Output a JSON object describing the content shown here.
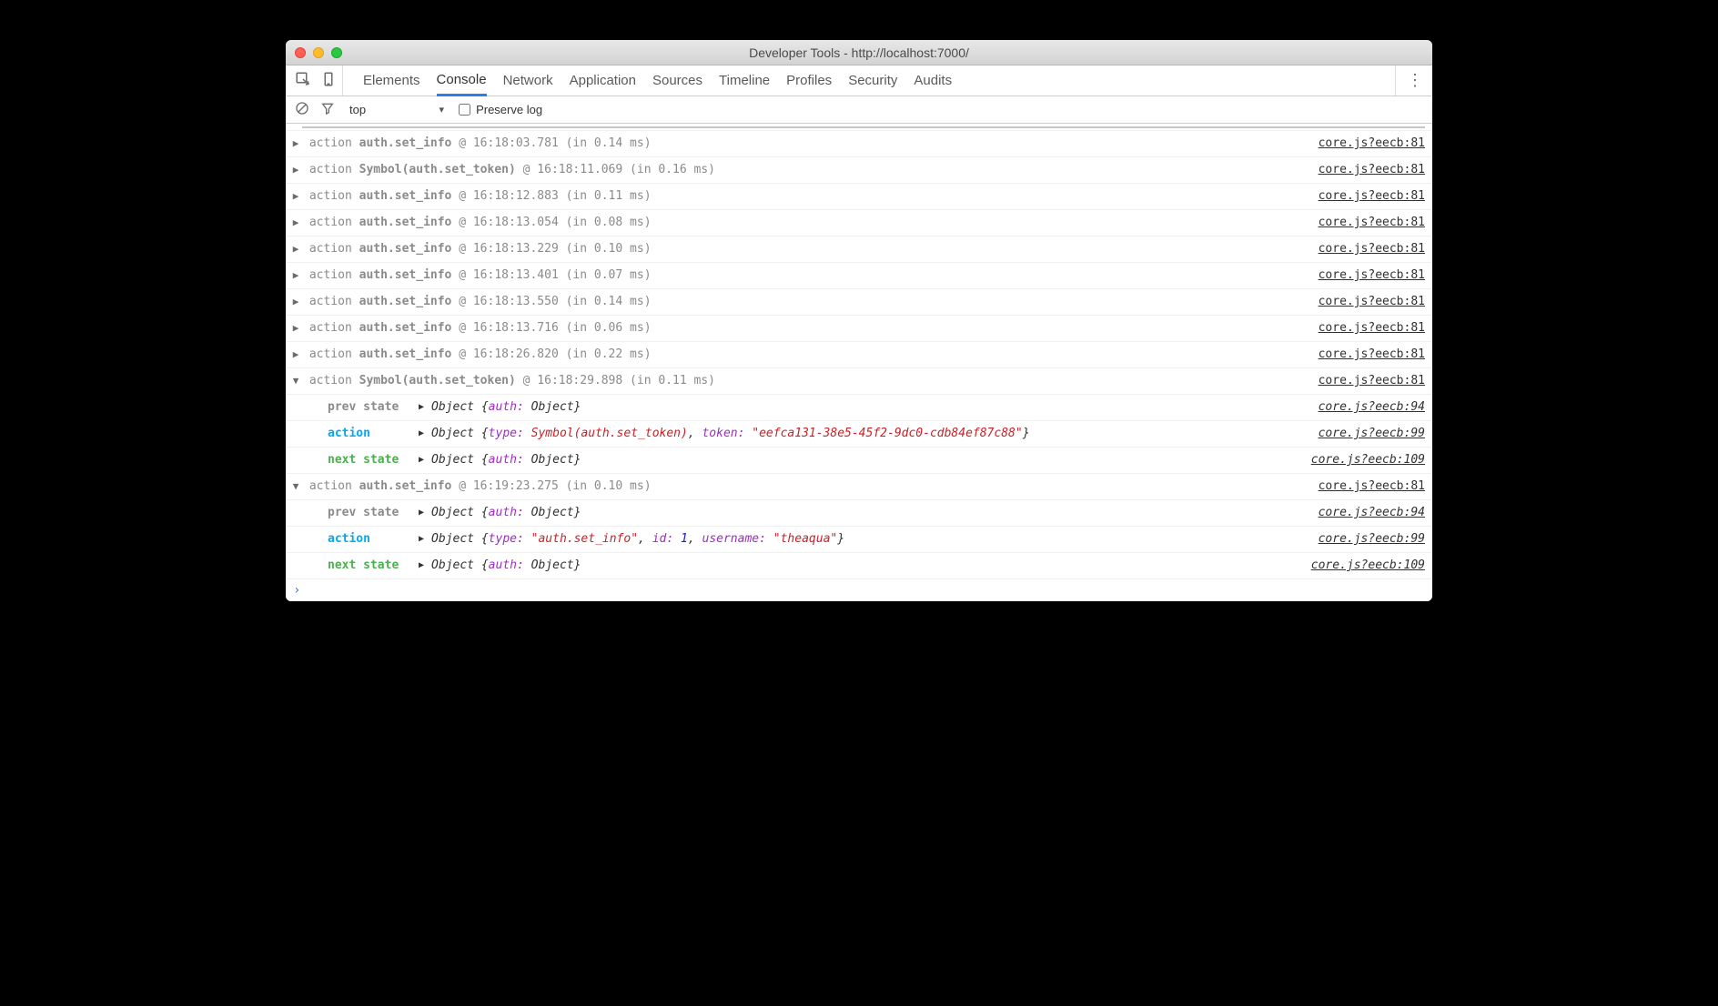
{
  "window": {
    "title": "Developer Tools - http://localhost:7000/"
  },
  "tabs": {
    "items": [
      "Elements",
      "Console",
      "Network",
      "Application",
      "Sources",
      "Timeline",
      "Profiles",
      "Security",
      "Audits"
    ],
    "active": "Console"
  },
  "toolbar": {
    "context": "top",
    "preserve_label": "Preserve log"
  },
  "src": {
    "line81": "core.js?eecb:81",
    "line94": "core.js?eecb:94",
    "line99": "core.js?eecb:99",
    "line109": "core.js?eecb:109"
  },
  "logs": [
    {
      "expanded": false,
      "name": "auth.set_info",
      "ts": "16:18:03.781",
      "dur": "0.14"
    },
    {
      "expanded": false,
      "name": "Symbol(auth.set_token)",
      "ts": "16:18:11.069",
      "dur": "0.16"
    },
    {
      "expanded": false,
      "name": "auth.set_info",
      "ts": "16:18:12.883",
      "dur": "0.11"
    },
    {
      "expanded": false,
      "name": "auth.set_info",
      "ts": "16:18:13.054",
      "dur": "0.08"
    },
    {
      "expanded": false,
      "name": "auth.set_info",
      "ts": "16:18:13.229",
      "dur": "0.10"
    },
    {
      "expanded": false,
      "name": "auth.set_info",
      "ts": "16:18:13.401",
      "dur": "0.07"
    },
    {
      "expanded": false,
      "name": "auth.set_info",
      "ts": "16:18:13.550",
      "dur": "0.14"
    },
    {
      "expanded": false,
      "name": "auth.set_info",
      "ts": "16:18:13.716",
      "dur": "0.06"
    },
    {
      "expanded": false,
      "name": "auth.set_info",
      "ts": "16:18:26.820",
      "dur": "0.22"
    },
    {
      "expanded": true,
      "name": "Symbol(auth.set_token)",
      "ts": "16:18:29.898",
      "dur": "0.11",
      "detail": {
        "prev": "Object {auth: Object}",
        "action_type": "Symbol(auth.set_token)",
        "action_rest": "token: \"eefca131-38e5-45f2-9dc0-cdb84ef87c88\"",
        "next": "Object {auth: Object}"
      }
    },
    {
      "expanded": true,
      "name": "auth.set_info",
      "ts": "16:19:23.275",
      "dur": "0.10",
      "detail": {
        "prev": "Object {auth: Object}",
        "action_type": "\"auth.set_info\"",
        "action_rest": "id: 1, username: \"theaqua\"",
        "next": "Object {auth: Object}"
      }
    }
  ],
  "labels": {
    "action_word": "action",
    "prev_state": "prev state",
    "action_label": "action",
    "next_state": "next state",
    "obj_auth": "Object {",
    "auth_key": "auth:",
    "obj_val": " Object}",
    "type_key": "type:",
    "token_key": "token:",
    "id_key": "id:",
    "username_key": "username:",
    "token_val": "\"eefca131-38e5-45f2-9dc0-cdb84ef87c88\"",
    "id_val": "1",
    "username_val": "\"theaqua\"",
    "type_val_str": "\"auth.set_info\"",
    "type_val_sym": "Symbol(auth.set_token)"
  }
}
